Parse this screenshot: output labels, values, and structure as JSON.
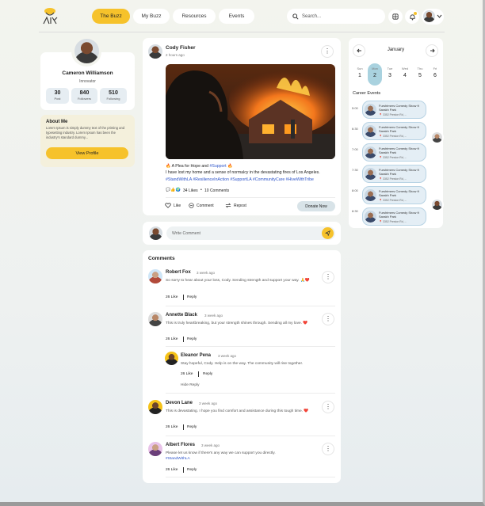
{
  "nav": {
    "tabs": [
      "The Buzz",
      "My Buzz",
      "Resources",
      "Events"
    ],
    "active_tab": "The Buzz",
    "search_placeholder": "Search..."
  },
  "colors": {
    "accent": "#f6c22b",
    "link": "#2d54c9",
    "event_bg": "#e4eef5",
    "selected_day": "#a9d2df"
  },
  "profile": {
    "name": "Cameron Williamson",
    "role": "Innovator",
    "stats": [
      {
        "value": "30",
        "label": "Post"
      },
      {
        "value": "840",
        "label": "Followers"
      },
      {
        "value": "510",
        "label": "Following"
      }
    ]
  },
  "about": {
    "title": "About Me",
    "text": "Lorem Ipsum is simply dummy text of the printing and typesetting industry. Lorem Ipsum has been the industry's standard dummy...",
    "button": "View Profile"
  },
  "post": {
    "author": "Cody Fisher",
    "time": "2 hours ago",
    "title_prefix": "🔥 A Plea for Hope and ",
    "title_hash": "#Support",
    "title_suffix": " 🔥",
    "body": "I have lost my home and a sense of normalcy in the devastating fires of Los Angeles.",
    "hashtags": "#StandWithLA #ResilienceInAction #SupportLA #CommunityCare #HiveWithTribe",
    "likes": "34 Likes",
    "comments_count": "10 Comments",
    "actions": {
      "like": "Like",
      "comment": "Comment",
      "repost": "Repost",
      "donate": "Donate Now"
    }
  },
  "composer": {
    "placeholder": "Write Comment"
  },
  "comments": {
    "title": "Comments",
    "items": [
      {
        "name": "Robert Fox",
        "time": "3 week ago",
        "text": "So sorry to hear about your loss, Cody. Sending strength and support your way. 🙏❤️",
        "likes": "26 Like",
        "reply": "Reply"
      },
      {
        "name": "Annette Black",
        "time": "3 week ago",
        "text": "This is truly heartbreaking, but your strength shines through. Sending all my love. ❤️",
        "likes": "26 Like",
        "reply": "Reply"
      },
      {
        "name": "Eleanor Pena",
        "time": "3 week ago",
        "text": "Stay hopeful, Cody. Help is on the way. The community will rise together.",
        "likes": "26 Like",
        "reply": "Reply"
      },
      {
        "name": "Devon Lane",
        "time": "3 week ago",
        "text": "This is devastating. I hope you find comfort and assistance during this tough time. ❤️",
        "likes": "26 Like",
        "reply": "Reply"
      },
      {
        "name": "Albert Flores",
        "time": "3 week ago",
        "text": "Please let us know if there's any way we can support you directly.",
        "hashtag": "#StandWithLA",
        "likes": "26 Like",
        "reply": "Reply"
      }
    ],
    "hide_reply": "Hide Reply"
  },
  "calendar": {
    "month": "January",
    "days": [
      {
        "name": "Sun",
        "num": "1"
      },
      {
        "name": "Mon",
        "num": "2"
      },
      {
        "name": "Tue",
        "num": "3"
      },
      {
        "name": "Wed",
        "num": "4"
      },
      {
        "name": "Thu",
        "num": "5"
      },
      {
        "name": "Fri",
        "num": "6"
      }
    ],
    "selected": "2",
    "events_title": "Career Events",
    "times": [
      "5:00",
      "6:30",
      "7:00",
      "7:30",
      "8:00",
      "8:30"
    ],
    "events": [
      {
        "title": "Furshtmers Comedy Show ft Sarakh Park",
        "meta": "📍 3352 Preston Rd, ..."
      },
      {
        "title": "Furshtmers Comedy Show ft Sarakh Park",
        "meta": "📍 3352 Preston Rd, ..."
      },
      {
        "title": "Furshtmers Comedy Show ft Sarakh Park",
        "meta": "📍 3352 Preston Rd, ..."
      },
      {
        "title": "Furshtmers Comedy Show ft Sarakh Park",
        "meta": "📍 3352 Preston Rd, ..."
      },
      {
        "title": "Furshtmers Comedy Show ft Sarakh Park",
        "meta": "📍 3352 Preston Rd, ..."
      },
      {
        "title": "Furshtmers Comedy Show ft Sarakh Park",
        "meta": "📍 3352 Preston Rd, ..."
      }
    ]
  }
}
